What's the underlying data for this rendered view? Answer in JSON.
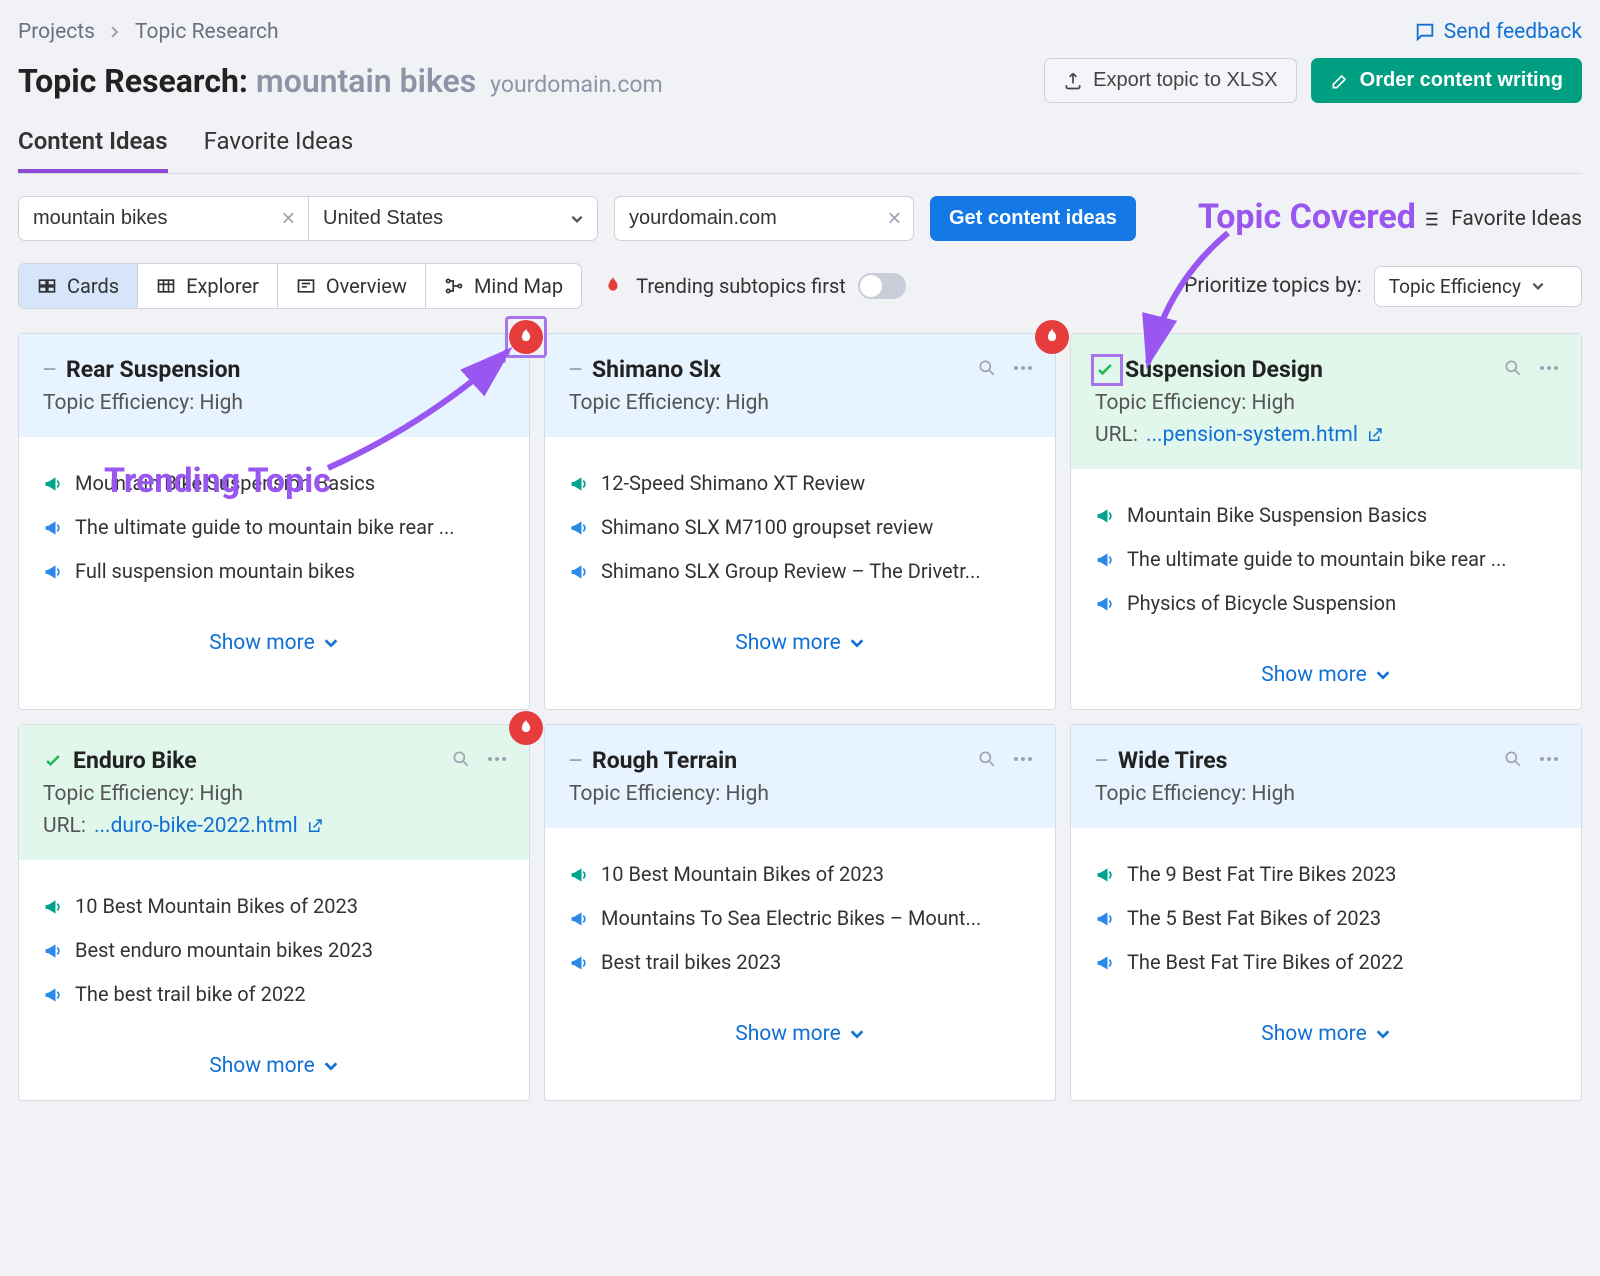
{
  "breadcrumb": {
    "projects": "Projects",
    "current": "Topic Research"
  },
  "feedback_label": "Send feedback",
  "title": {
    "prefix": "Topic Research:",
    "query": "mountain bikes",
    "domain": "yourdomain.com"
  },
  "actions": {
    "export": "Export topic to XLSX",
    "order": "Order content writing"
  },
  "tabs": {
    "content_ideas": "Content Ideas",
    "favorite_ideas": "Favorite Ideas"
  },
  "filters": {
    "query_value": "mountain bikes",
    "location_value": "United States",
    "domain_value": "yourdomain.com",
    "get_ideas_btn": "Get content ideas",
    "favorite_link": "Favorite Ideas"
  },
  "views": {
    "cards": "Cards",
    "explorer": "Explorer",
    "overview": "Overview",
    "mindmap": "Mind Map"
  },
  "trending_toggle_label": "Trending subtopics first",
  "prioritize": {
    "label": "Prioritize topics by:",
    "value": "Topic Efficiency"
  },
  "annotations": {
    "trending": "Trending Topic",
    "covered": "Topic Covered"
  },
  "cards": [
    {
      "title": "Rear Suspension",
      "efficiency": "Topic Efficiency: High",
      "covered": false,
      "trending": true,
      "trending_highlight": true,
      "headlines": [
        {
          "type": "green",
          "text": "Mountain Bike Suspension Basics"
        },
        {
          "type": "blue",
          "text": "The ultimate guide to mountain bike rear ..."
        },
        {
          "type": "blue",
          "text": "Full suspension mountain bikes"
        }
      ],
      "show_more": "Show more"
    },
    {
      "title": "Shimano Slx",
      "efficiency": "Topic Efficiency: High",
      "covered": false,
      "trending": true,
      "headlines": [
        {
          "type": "green",
          "text": "12-Speed Shimano XT Review"
        },
        {
          "type": "blue",
          "text": "Shimano SLX M7100 groupset review"
        },
        {
          "type": "blue",
          "text": "Shimano SLX Group Review – The Drivetr..."
        }
      ],
      "show_more": "Show more"
    },
    {
      "title": "Suspension Design",
      "efficiency": "Topic Efficiency: High",
      "covered": true,
      "covered_highlight": true,
      "url_label": "URL:",
      "url_text": "...pension-system.html",
      "headlines": [
        {
          "type": "green",
          "text": "Mountain Bike Suspension Basics"
        },
        {
          "type": "blue",
          "text": "The ultimate guide to mountain bike rear ..."
        },
        {
          "type": "blue",
          "text": "Physics of Bicycle Suspension"
        }
      ],
      "show_more": "Show more"
    },
    {
      "title": "Enduro Bike",
      "efficiency": "Topic Efficiency: High",
      "covered": true,
      "trending": true,
      "url_label": "URL:",
      "url_text": "...duro-bike-2022.html",
      "headlines": [
        {
          "type": "green",
          "text": "10 Best Mountain Bikes of 2023"
        },
        {
          "type": "blue",
          "text": "Best enduro mountain bikes 2023"
        },
        {
          "type": "blue",
          "text": "The best trail bike of 2022"
        }
      ],
      "show_more": "Show more"
    },
    {
      "title": "Rough Terrain",
      "efficiency": "Topic Efficiency: High",
      "covered": false,
      "headlines": [
        {
          "type": "green",
          "text": "10 Best Mountain Bikes of 2023"
        },
        {
          "type": "blue",
          "text": "Mountains To Sea Electric Bikes – Mount..."
        },
        {
          "type": "blue",
          "text": "Best trail bikes 2023"
        }
      ],
      "show_more": "Show more"
    },
    {
      "title": "Wide Tires",
      "efficiency": "Topic Efficiency: High",
      "covered": false,
      "headlines": [
        {
          "type": "green",
          "text": "The 9 Best Fat Tire Bikes 2023"
        },
        {
          "type": "blue",
          "text": "The 5 Best Fat Bikes of 2023"
        },
        {
          "type": "blue",
          "text": "The Best Fat Tire Bikes of 2022"
        }
      ],
      "show_more": "Show more"
    }
  ]
}
